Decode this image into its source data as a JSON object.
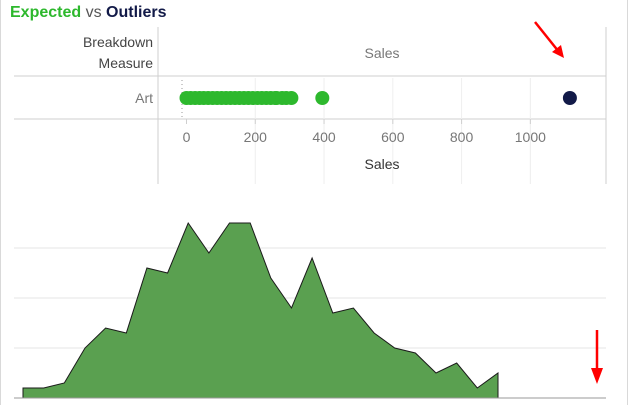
{
  "title": {
    "expected": "Expected",
    "vs": "vs",
    "outliers": "Outliers"
  },
  "colors": {
    "expected": "#2db82d",
    "outlier": "#121a48",
    "area_fill": "#5aa050",
    "area_stroke": "#1a1a1a",
    "annotation_arrow": "#ff0000",
    "grid": "#e6e6e6"
  },
  "chart_data": [
    {
      "type": "scatter",
      "row_header": "Breakdown Measure",
      "column_header": "Sales",
      "rows": [
        "Art"
      ],
      "xlabel": "Sales",
      "xlim": [
        -80,
        1220
      ],
      "xticks": [
        0,
        200,
        400,
        600,
        800,
        1000
      ],
      "series": [
        {
          "name": "Expected",
          "color": "#2db82d",
          "points": [
            {
              "row": "Art",
              "x": 0
            },
            {
              "row": "Art",
              "x": 12
            },
            {
              "row": "Art",
              "x": 25
            },
            {
              "row": "Art",
              "x": 38
            },
            {
              "row": "Art",
              "x": 50
            },
            {
              "row": "Art",
              "x": 63
            },
            {
              "row": "Art",
              "x": 76
            },
            {
              "row": "Art",
              "x": 89
            },
            {
              "row": "Art",
              "x": 102
            },
            {
              "row": "Art",
              "x": 115
            },
            {
              "row": "Art",
              "x": 128
            },
            {
              "row": "Art",
              "x": 141
            },
            {
              "row": "Art",
              "x": 154
            },
            {
              "row": "Art",
              "x": 167
            },
            {
              "row": "Art",
              "x": 180
            },
            {
              "row": "Art",
              "x": 193
            },
            {
              "row": "Art",
              "x": 206
            },
            {
              "row": "Art",
              "x": 219
            },
            {
              "row": "Art",
              "x": 232
            },
            {
              "row": "Art",
              "x": 245
            },
            {
              "row": "Art",
              "x": 258
            },
            {
              "row": "Art",
              "x": 262
            },
            {
              "row": "Art",
              "x": 278
            },
            {
              "row": "Art",
              "x": 290
            },
            {
              "row": "Art",
              "x": 305
            },
            {
              "row": "Art",
              "x": 395
            }
          ]
        },
        {
          "name": "Outliers",
          "color": "#121a48",
          "points": [
            {
              "row": "Art",
              "x": 1115
            }
          ]
        }
      ],
      "annotations": [
        {
          "type": "arrow",
          "target": "outlier point",
          "color": "#ff0000"
        }
      ]
    },
    {
      "type": "area",
      "x": [
        0,
        1,
        2,
        3,
        4,
        5,
        6,
        7,
        8,
        9,
        10,
        11,
        12,
        13,
        14,
        15,
        16,
        17,
        18,
        19,
        20,
        21,
        22,
        23
      ],
      "values": [
        2,
        2,
        3,
        10,
        14,
        13,
        26,
        25,
        35,
        29,
        35,
        35,
        24,
        18,
        28,
        17,
        18,
        13,
        10,
        9,
        5,
        7,
        2,
        5
      ],
      "ylim": [
        0,
        40
      ],
      "grid": true,
      "annotations": [
        {
          "type": "arrow",
          "target": "far right tail of distribution",
          "color": "#ff0000"
        }
      ]
    }
  ]
}
